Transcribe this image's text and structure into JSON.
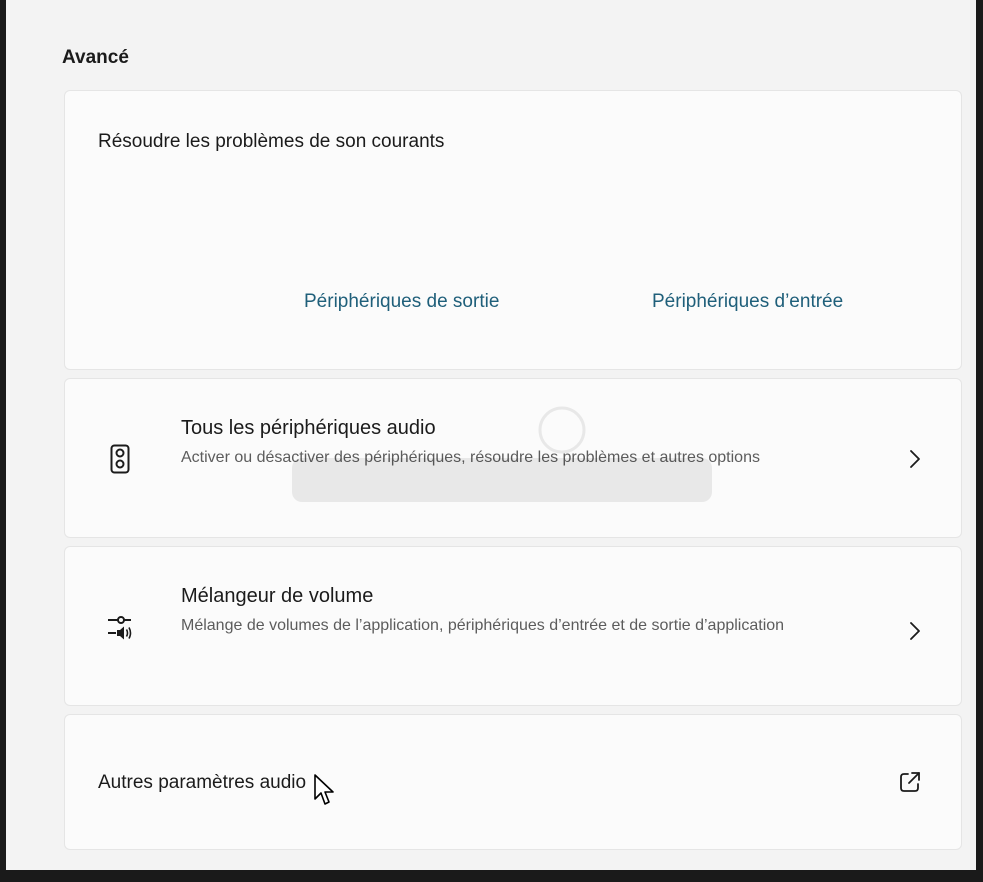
{
  "section": {
    "title": "Avancé"
  },
  "troubleshoot": {
    "title": "Résoudre les problèmes de son courants",
    "output_link": "Périphériques de sortie",
    "input_link": "Périphériques d’entrée"
  },
  "all_devices": {
    "title": "Tous les périphériques audio",
    "description": "Activer ou désactiver des périphériques, résoudre les problèmes et autres options",
    "icon": "speaker-icon"
  },
  "volume_mixer": {
    "title": "Mélangeur de volume",
    "description": "Mélange de volumes de l’application, périphériques d’entrée et de sortie d’application",
    "icon": "volume-mixer-icon"
  },
  "more_settings": {
    "label": "Autres paramètres audio",
    "icon": "external-link-icon"
  },
  "colors": {
    "background": "#f3f3f3",
    "card": "#fbfbfb",
    "link": "#1f5f7a",
    "secondary_text": "#5c5c5c"
  }
}
